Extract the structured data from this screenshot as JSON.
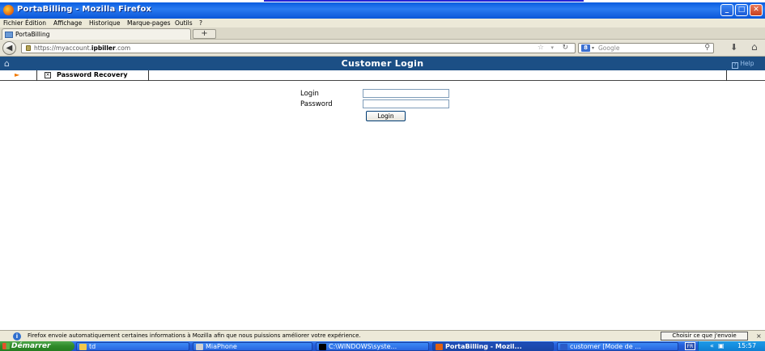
{
  "window": {
    "title": "PortaBilling - Mozilla Firefox",
    "buttons": {
      "minimize": "_",
      "maximize": "□",
      "close": "✕"
    }
  },
  "menubar": [
    "Fichier",
    "Édition",
    "Affichage",
    "Historique",
    "Marque-pages",
    "Outils",
    "?"
  ],
  "tabs": [
    {
      "label": "PortaBilling"
    }
  ],
  "new_tab_label": "+",
  "navbar": {
    "url_prefix": "https://myaccount.",
    "url_domain": "ipbiller",
    "url_suffix": ".com",
    "search_placeholder": "Google"
  },
  "page": {
    "header_title": "Customer Login",
    "help_label": "Help",
    "subnav_tab_label": "Password Recovery",
    "login_label": "Login",
    "password_label": "Password",
    "login_value": "",
    "password_value": "",
    "login_button_label": "Login"
  },
  "notification": {
    "message": "Firefox envoie automatiquement certaines informations à Mozilla afin que nous puissions améliorer votre expérience.",
    "button_label": "Choisir ce que j'envoie",
    "close": "×"
  },
  "taskbar": {
    "start_label": "Démarrer",
    "tasks": [
      {
        "label": "td"
      },
      {
        "label": "MiaPhone"
      },
      {
        "label": "C:\\WINDOWS\\syste..."
      },
      {
        "label": "PortaBilling - Mozil..."
      },
      {
        "label": "customer [Mode de ..."
      }
    ],
    "lang": "FR",
    "clock": "15:57"
  }
}
